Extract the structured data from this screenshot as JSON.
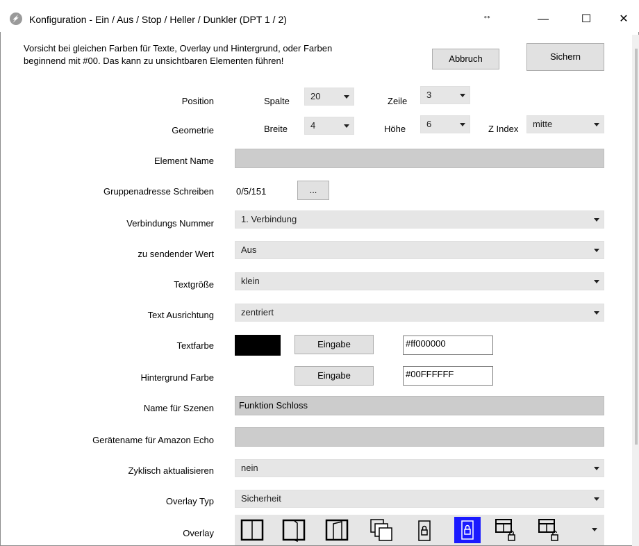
{
  "window": {
    "title": "Konfiguration - Ein / Aus / Stop / Heller / Dunkler (DPT 1 / 2)",
    "resize_glyph": "↔",
    "minimize_glyph": "—",
    "maximize_glyph": "☐",
    "close_glyph": "✕"
  },
  "warning": {
    "line1": "Vorsicht bei gleichen Farben für Texte, Overlay und Hintergrund, oder Farben",
    "line2": "beginnend mit #00. Das kann zu unsichtbaren Elementen führen!"
  },
  "buttons": {
    "abort": "Abbruch",
    "save": "Sichern",
    "ellipsis": "...",
    "eingabe1": "Eingabe",
    "eingabe2": "Eingabe"
  },
  "position": {
    "label": "Position",
    "spalte_label": "Spalte",
    "spalte_value": "20",
    "zeile_label": "Zeile",
    "zeile_value": "3"
  },
  "geometrie": {
    "label": "Geometrie",
    "breite_label": "Breite",
    "breite_value": "4",
    "hoehe_label": "Höhe",
    "hoehe_value": "6",
    "zindex_label": "Z Index",
    "zindex_value": "mitte"
  },
  "fields": {
    "element_name_label": "Element Name",
    "element_name_value": "",
    "gruppenadresse_label": "Gruppenadresse Schreiben",
    "gruppenadresse_value": "0/5/151",
    "verbindung_label": "Verbindungs Nummer",
    "verbindung_value": "1. Verbindung",
    "wert_label": "zu sendender Wert",
    "wert_value": "Aus",
    "textgroesse_label": "Textgröße",
    "textgroesse_value": "klein",
    "ausrichtung_label": "Text Ausrichtung",
    "ausrichtung_value": "zentriert",
    "textfarbe_label": "Textfarbe",
    "textfarbe_value": "#ff000000",
    "hintergrund_label": "Hintergrund Farbe",
    "hintergrund_value": "#00FFFFFF",
    "szenen_label": "Name für Szenen",
    "szenen_value": "Funktion Schloss",
    "echo_label": "Gerätename für Amazon Echo",
    "echo_value": "",
    "zyklisch_label": "Zyklisch aktualisieren",
    "zyklisch_value": "nein",
    "overlay_typ_label": "Overlay Typ",
    "overlay_typ_value": "Sicherheit",
    "overlay_label": "Overlay"
  },
  "colors": {
    "textfarbe_swatch": "#000000",
    "overlay_selected": "#1a1aff"
  },
  "overlay_icons": [
    "door-closed-icon",
    "door-open-icon",
    "door-ajar-icon",
    "double-door-icon",
    "lock-icon",
    "lock-selected-icon",
    "window-lock-icon",
    "window-unlock-icon"
  ]
}
